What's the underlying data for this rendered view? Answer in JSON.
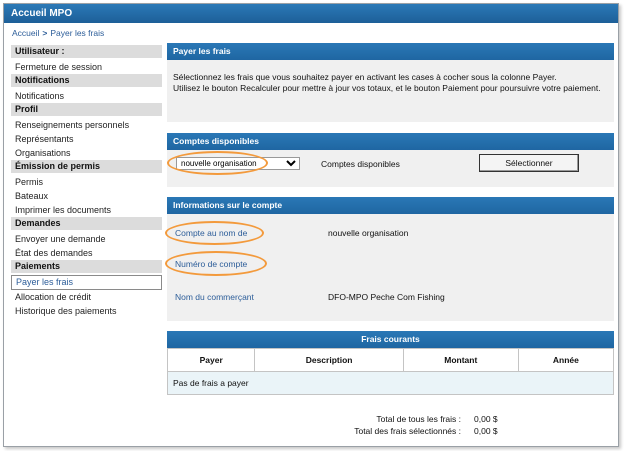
{
  "app": {
    "title": "Accueil MPO"
  },
  "breadcrumb": {
    "home": "Accueil",
    "separator": ">",
    "current": "Payer les frais"
  },
  "sidebar": {
    "sections": [
      {
        "heading": "Utilisateur :",
        "items": [
          "Fermeture de session"
        ]
      },
      {
        "heading": "Notifications",
        "items": [
          "Notifications"
        ]
      },
      {
        "heading": "Profil",
        "items": [
          "Renseignements personnels",
          "Représentants",
          "Organisations"
        ]
      },
      {
        "heading": "Émission de permis",
        "items": [
          "Permis",
          "Bateaux",
          "Imprimer les documents"
        ]
      },
      {
        "heading": "Demandes",
        "items": [
          "Envoyer une demande",
          "État des demandes"
        ]
      },
      {
        "heading": "Paiements",
        "items": [
          "Payer les frais",
          "Allocation de crédit",
          "Historique des paiements"
        ]
      }
    ],
    "active_item": "Payer les frais"
  },
  "pay_panel": {
    "title": "Payer les frais",
    "intro_line1": "Sélectionnez les frais que vous souhaitez payer en activant les cases à cocher sous la colonne Payer.",
    "intro_line2": "Utilisez le bouton Recalculer pour mettre à jour vos totaux, et le bouton Paiement pour poursuivre votre paiement."
  },
  "accounts_panel": {
    "title": "Comptes disponibles",
    "select_value": "nouvelle organisation",
    "label": "Comptes disponibles",
    "select_button": "Sélectionner"
  },
  "account_info": {
    "title": "Informations sur le compte",
    "account_name_label": "Compte au nom de",
    "account_name_value": "nouvelle organisation",
    "account_number_label": "Numéro de compte",
    "account_number_value": "",
    "merchant_label": "Nom du commerçant",
    "merchant_value": "DFO-MPO Peche Com Fishing"
  },
  "fees": {
    "title": "Frais courants",
    "columns": [
      "Payer",
      "Description",
      "Montant",
      "Année"
    ],
    "empty_message": "Pas de frais a payer"
  },
  "totals": {
    "all_label": "Total de tous les frais :",
    "all_value": "0,00 $",
    "selected_label": "Total des frais sélectionnés :",
    "selected_value": "0,00 $"
  },
  "colors": {
    "header_blue": "#1f66a2",
    "annotation_orange": "#f39a3c",
    "link_blue": "#2c5d99"
  }
}
